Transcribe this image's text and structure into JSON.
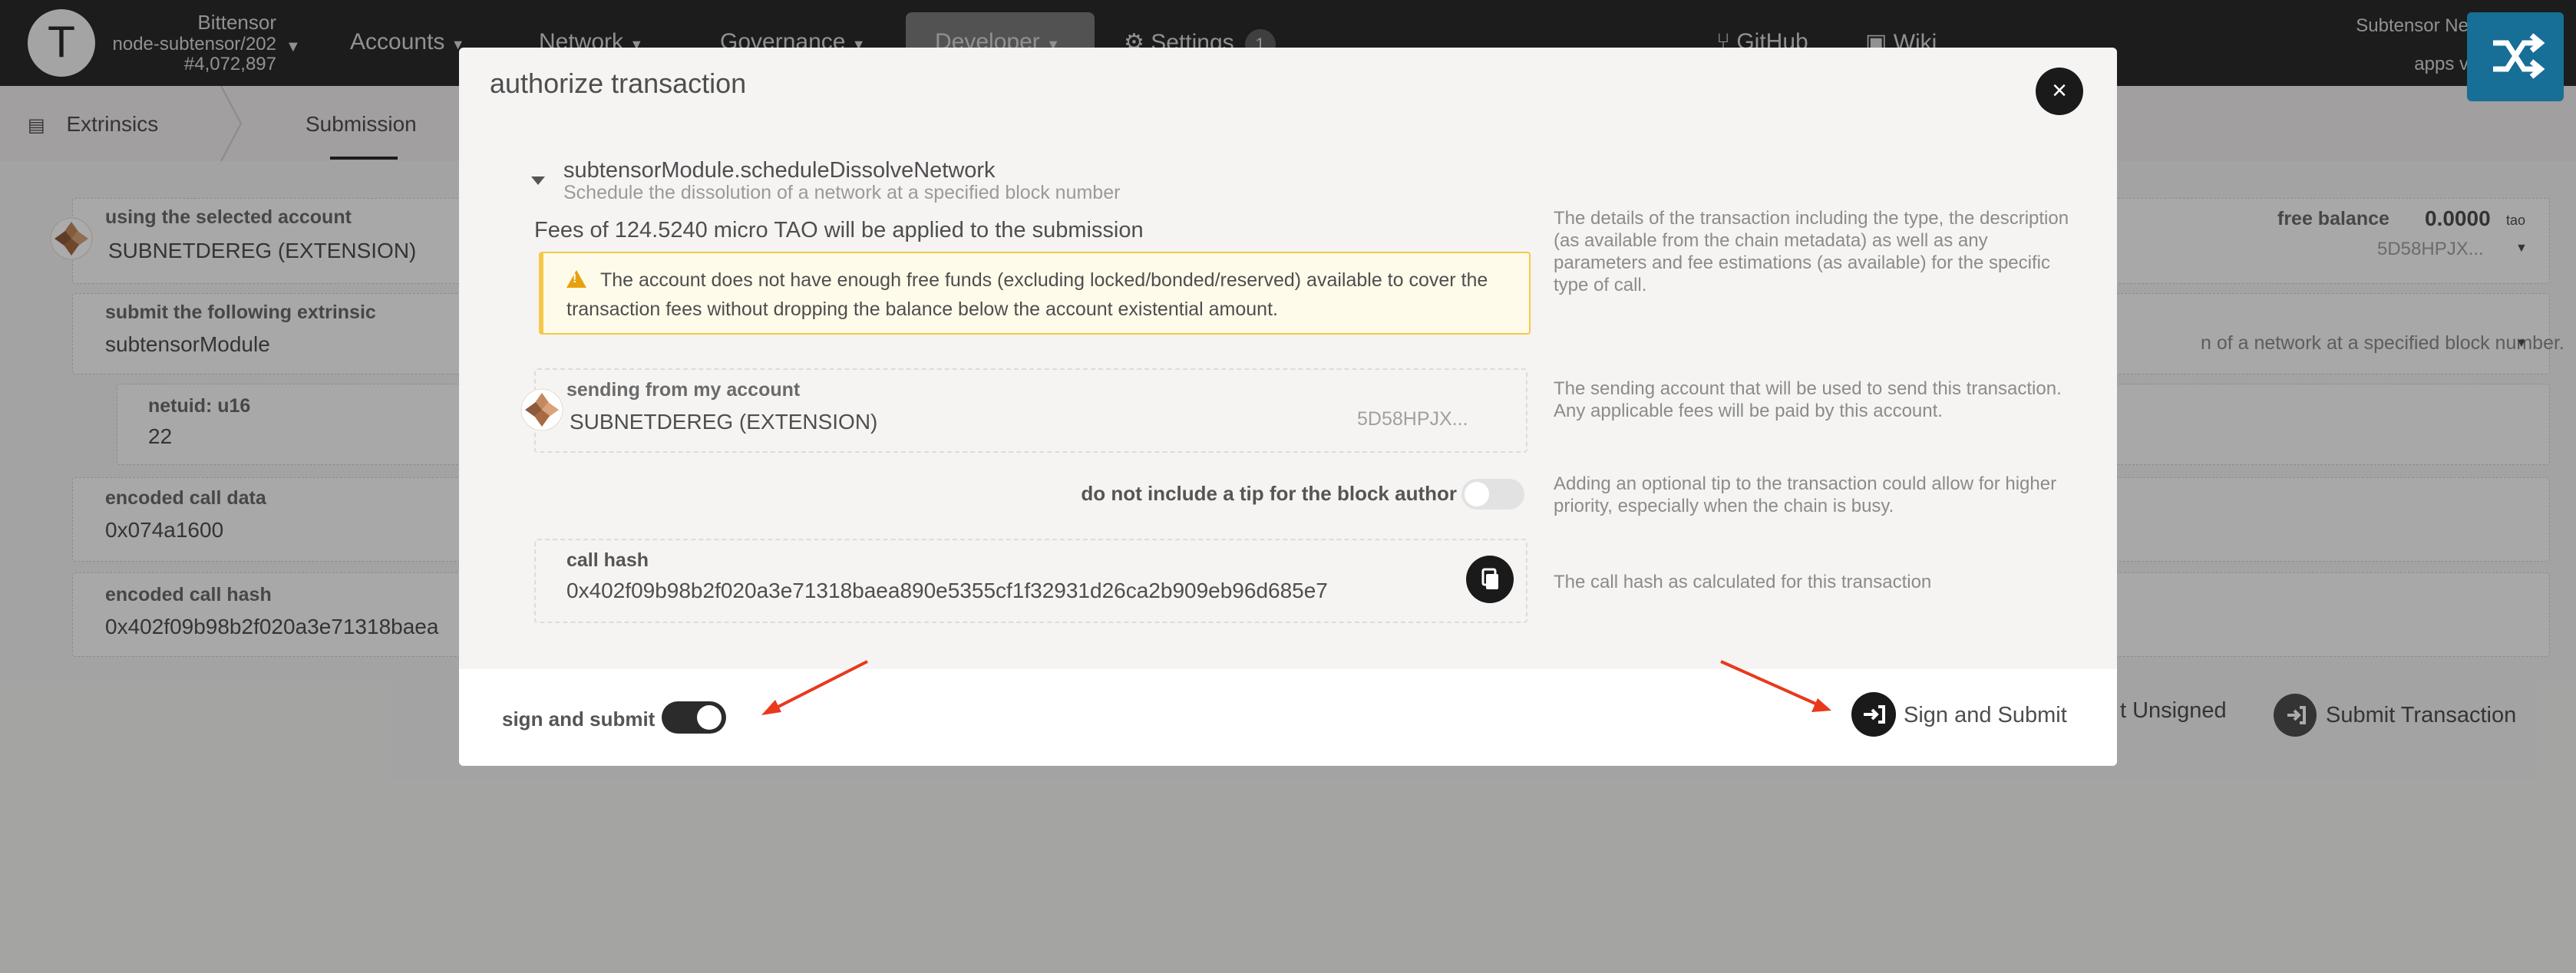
{
  "topbar": {
    "chain_name": "Bittensor",
    "node_name": "node-subtensor/202",
    "block_number": "#4,072,897",
    "nav": [
      "Accounts",
      "Network",
      "Governance",
      "Developer",
      "Settings"
    ],
    "settings_badge": "1",
    "links": [
      "GitHub",
      "Wiki"
    ],
    "right_network": "Subtensor Ne",
    "right_apps": "apps v"
  },
  "subnav": {
    "extrinsics": "Extrinsics",
    "submission": "Submission"
  },
  "background": {
    "using_label": "using the selected account",
    "using_value": "SUBNETDEREG (EXTENSION)",
    "submit_label": "submit the following extrinsic",
    "submit_value": "subtensorModule",
    "netuid_label": "netuid: u16",
    "netuid_value": "22",
    "encoded_data_label": "encoded call data",
    "encoded_data_value": "0x074a1600",
    "encoded_hash_label": "encoded call hash",
    "encoded_hash_value": "0x402f09b98b2f020a3e71318baea",
    "free_balance_label": "free balance",
    "free_balance_value": "0.0000",
    "free_balance_unit": "tao",
    "address_short": "5D58HPJX...",
    "call_desc_fragment": "n of a network at a specified block number.",
    "submit_unsigned": "t Unsigned",
    "submit_transaction": "Submit Transaction"
  },
  "modal": {
    "title": "authorize transaction",
    "close_glyph": "×",
    "call_name": "subtensorModule.scheduleDissolveNetwork",
    "call_description": "Schedule the dissolution of a network at a specified block number",
    "fees_text": "Fees of 124.5240 micro TAO will be applied to the submission",
    "warning_text": "The account does not have enough free funds (excluding locked/bonded/reserved) available to cover the transaction fees without dropping the balance below the account existential amount.",
    "help_details": "The details of the transaction including the type, the description (as available from the chain metadata) as well as any parameters and fee estimations (as available) for the specific type of call.",
    "sending_label": "sending from my account",
    "sending_name": "SUBNETDEREG (EXTENSION)",
    "sending_address": "5D58HPJX...",
    "help_sending": "The sending account that will be used to send this transaction. Any applicable fees will be paid by this account.",
    "tip_label": "do not include a tip for the block author",
    "help_tip": "Adding an optional tip to the transaction could allow for higher priority, especially when the chain is busy.",
    "call_hash_label": "call hash",
    "call_hash_value": "0x402f09b98b2f020a3e71318baea890e5355cf1f32931d26ca2b909eb96d685e7",
    "help_hash": "The call hash as calculated for this transaction",
    "sign_submit_toggle_label": "sign and submit",
    "sign_submit_button": "Sign and Submit"
  },
  "colors": {
    "accent": "#176e96",
    "warning_border": "#f6c84a",
    "warning_bg": "#fffbea",
    "annotation_arrow": "#e8391d"
  },
  "icons": [
    "shuffle-icon",
    "warning-icon",
    "copy-icon",
    "sign-in-icon",
    "close-icon",
    "github-icon",
    "wiki-icon",
    "settings-icon",
    "extrinsics-icon"
  ]
}
